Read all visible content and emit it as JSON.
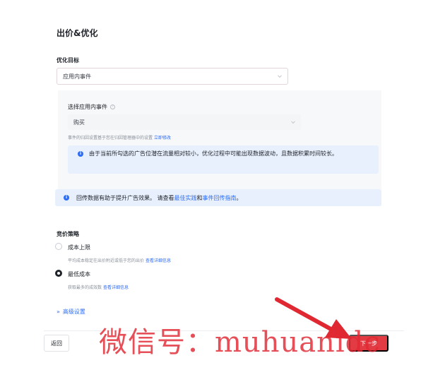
{
  "section": {
    "title": "出价&优化"
  },
  "optimization_goal": {
    "label": "优化目标",
    "selected": "应用内事件"
  },
  "in_app_event": {
    "label": "选择应用内事件",
    "selected": "购买",
    "hint_prefix": "事件的归因设置基于您在归因管理器中的设置",
    "hint_link": "立即修改",
    "info": "由于当前所勾选的广告位潜在流量相对较小，优化过程中可能出现数据波动，且数据积累时间较长。"
  },
  "tip": {
    "prefix": "回传数据有助于提升广告效果。 请查看",
    "link1": "最佳实践",
    "middle": "和",
    "link2": "事件回传指南",
    "suffix": "。"
  },
  "bid_strategy": {
    "label": "竞价策略",
    "options": [
      {
        "label": "成本上限",
        "desc": "平均成本稳定在出价附近或低于您的出价",
        "link": "查看详细信息",
        "selected": false
      },
      {
        "label": "最低成本",
        "desc": "获取最多的成效数",
        "link": "查看详细信息",
        "selected": true
      }
    ]
  },
  "advanced": {
    "label": "高级设置",
    "icon": "double-chevron-down-icon"
  },
  "footer": {
    "back_label": "返回",
    "next_label": "下一步"
  },
  "watermark": {
    "text": "微信号：muhuanidc"
  },
  "colors": {
    "accent_blue": "#2d6df6",
    "primary_red": "#e23b43",
    "info_bg": "#e8f0fe"
  }
}
